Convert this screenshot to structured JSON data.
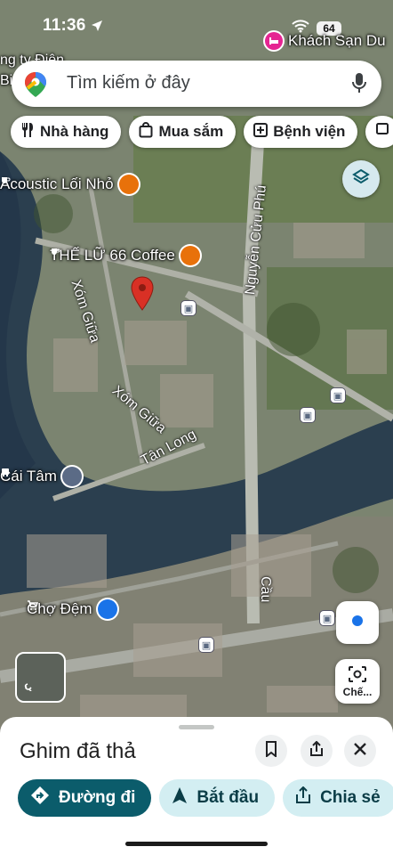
{
  "status": {
    "time": "11:36",
    "battery": "64",
    "notification_label": "Khách Sạn Du"
  },
  "search": {
    "placeholder": "Tìm kiếm ở đây"
  },
  "chips": [
    {
      "label": "Nhà hàng",
      "icon": "fork-knife-icon"
    },
    {
      "label": "Mua sắm",
      "icon": "shopping-bag-icon"
    },
    {
      "label": "Bệnh viện",
      "icon": "hospital-icon"
    }
  ],
  "map_labels": {
    "top_left_fragment_1": "ng ty Điện",
    "top_left_fragment_2": "Bi",
    "acoustic": "Acoustic Lối Nhỏ",
    "the_lu": "THẾ LỮ 66 Coffee",
    "xom_giua_1": "Xóm Giữa",
    "xom_giua_2": "Xóm Giữa",
    "tan_long": "Tân Long",
    "nguyen_cuu_phu": "Nguyễn Cửu Phú",
    "cai_tam": "Cái Tâm",
    "cho_dem": "Chợ Đệm",
    "cau": "Cầu"
  },
  "controls": {
    "lens_label": "Chế..."
  },
  "sheet": {
    "title": "Ghim đã thả",
    "directions_label": "Đường đi",
    "start_label": "Bắt đầu",
    "share_label": "Chia sẻ"
  },
  "colors": {
    "primary": "#0b5c6b",
    "secondary": "#d3eef2",
    "pin": "#d93025",
    "food_poi": "#e8710a",
    "shop_poi": "#1a73e8"
  }
}
